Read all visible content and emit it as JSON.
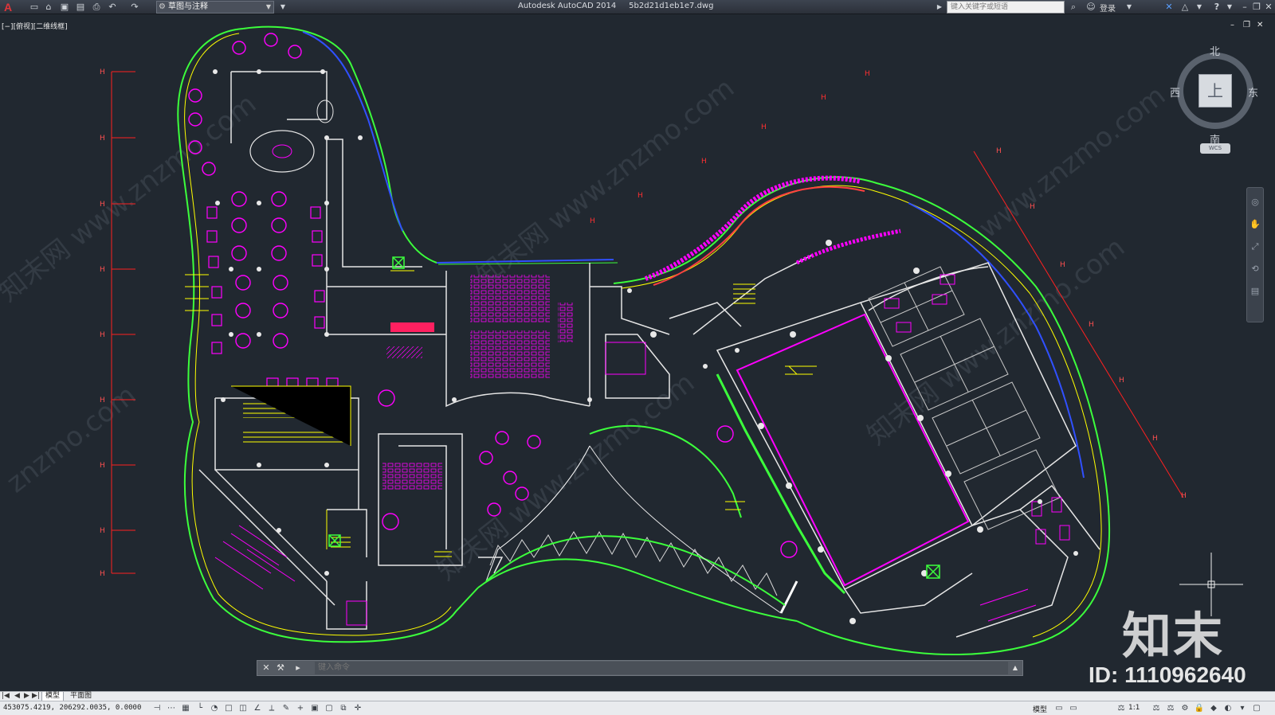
{
  "titlebar": {
    "app_logo": "A",
    "workspace": "草图与注释",
    "title": "Autodesk AutoCAD 2014     5b2d21d1eb1e7.dwg",
    "search_placeholder": "键入关键字或短语",
    "login": "登录",
    "help": "?"
  },
  "viewport": {
    "label": "[−][俯视][二维线框]"
  },
  "viewcube": {
    "north": "北",
    "south": "南",
    "east": "东",
    "west": "西",
    "face": "上",
    "wcs": "WCS"
  },
  "watermark": {
    "brand": "知末",
    "id": "ID: 1110962640"
  },
  "commandline": {
    "placeholder": "键入命令"
  },
  "layout_tabs": [
    "模型",
    "平面图"
  ],
  "statusbar": {
    "coords": "453075.4219, 206292.0035, 0.0000",
    "model": "模型",
    "scale": "1:1"
  },
  "icons": {
    "app": "autocad-logo-icon",
    "new": "new-file-icon",
    "open": "open-file-icon",
    "save": "save-icon",
    "saveas": "save-as-icon",
    "plot": "plot-icon",
    "undo": "undo-icon",
    "redo": "redo-icon"
  },
  "colors": {
    "background": "#212830",
    "magenta": "#ff00ff",
    "green": "#3cff3c",
    "yellow": "#ffff00",
    "red": "#ff2020",
    "white": "#ffffff",
    "blue": "#3050ff"
  }
}
